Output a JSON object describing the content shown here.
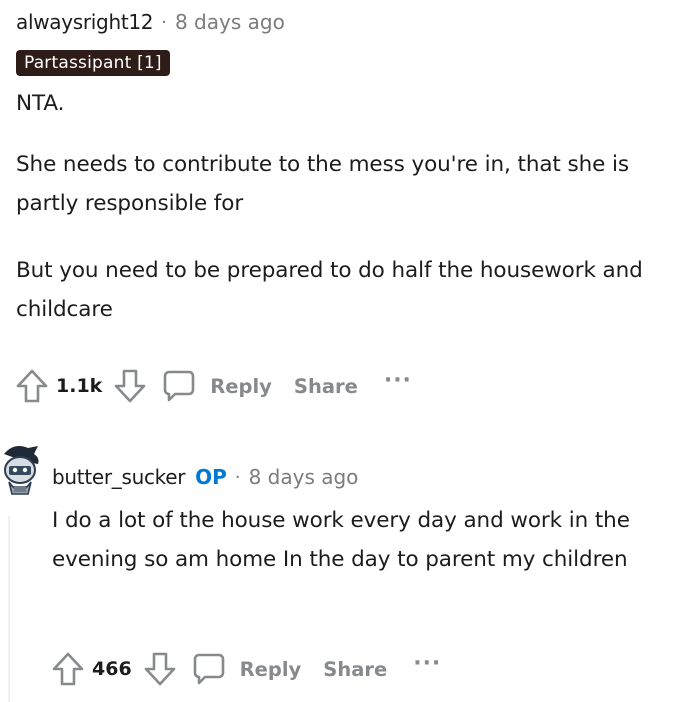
{
  "top_comment": {
    "username": "alwaysright12",
    "separator": "·",
    "timestamp": "8 days ago",
    "flair": "Partassipant [1]",
    "paragraphs": [
      "NTA.",
      "She needs to contribute to the mess you're in, that she is partly responsible for",
      "But you need to be prepared to do half the housework and childcare"
    ],
    "score": "1.1k",
    "reply_label": "Reply",
    "share_label": "Share",
    "more_label": "···"
  },
  "reply_comment": {
    "username": "butter_sucker",
    "op_badge": "OP",
    "separator": "·",
    "timestamp": "8 days ago",
    "paragraphs": [
      "I do a lot of the house work every day and work in the evening so am home In the day to parent my children"
    ],
    "score": "466",
    "reply_label": "Reply",
    "share_label": "Share",
    "more_label": "···"
  },
  "icons": {
    "upvote": "upvote-arrow-icon",
    "downvote": "downvote-arrow-icon",
    "reply": "speech-bubble-icon",
    "more": "ellipsis-icon",
    "avatar": "snoo-avatar"
  },
  "colors": {
    "flair_bg": "#2e1c18",
    "op_blue": "#0079d3",
    "muted_text": "#878a8c",
    "thread_line": "#edeff1"
  }
}
